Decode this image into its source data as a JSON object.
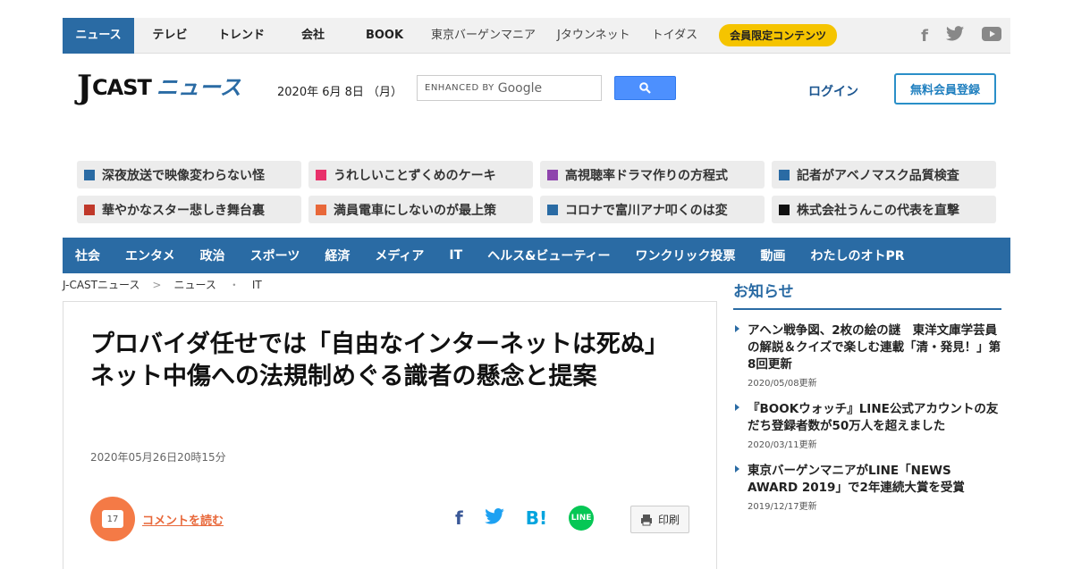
{
  "topnav": {
    "items": [
      "ニュース",
      "テレビ",
      "トレンド",
      "会社",
      "BOOK"
    ],
    "extra": [
      "東京バーゲンマニア",
      "Jタウンネット",
      "トイダス"
    ],
    "member": "会員限定コンテンツ",
    "social": [
      "facebook-icon",
      "twitter-icon",
      "youtube-icon"
    ]
  },
  "header": {
    "logo_j": "J",
    "logo_cast": "CAST",
    "logo_news": "ニュース",
    "date": "2020年 6月 8日 （月）",
    "search_label": "ENHANCED BY",
    "search_brand": "Google",
    "login": "ログイン",
    "register": "無料会員登録"
  },
  "headlines": [
    {
      "text": "深夜放送で映像変わらない怪",
      "color": "#2a6ba4"
    },
    {
      "text": "うれしいことずくめのケーキ",
      "color": "#e8306a"
    },
    {
      "text": "高視聴率ドラマ作りの方程式",
      "color": "#8e44ad"
    },
    {
      "text": "記者がアベノマスク品質検査",
      "color": "#2a6ba4"
    },
    {
      "text": "華やかなスター悲しき舞台裏",
      "color": "#c0392b"
    },
    {
      "text": "満員電車にしないのが最上策",
      "color": "#e8683a"
    },
    {
      "text": "コロナで富川アナ叩くのは変",
      "color": "#2a6ba4"
    },
    {
      "text": "株式会社うんこの代表を直撃",
      "color": "#111111"
    }
  ],
  "catnav": [
    "社会",
    "エンタメ",
    "政治",
    "スポーツ",
    "経済",
    "メディア",
    "IT",
    "ヘルス&ビューティー",
    "ワンクリック投票",
    "動画",
    "わたしのオトPR"
  ],
  "breadcrumb": {
    "home": "J-CASTニュース",
    "sep": ">",
    "section": "ニュース",
    "dot": "・",
    "sub": "IT"
  },
  "article": {
    "title": "プロバイダ任せでは「自由なインターネットは死ぬ」　ネット中傷への法規制めぐる識者の懸念と提案",
    "date": "2020年05月26日20時15分",
    "comment_count": "17",
    "comment_link": "コメントを読む",
    "print": "印刷"
  },
  "sidebar": {
    "heading": "お知らせ",
    "items": [
      {
        "title": "アヘン戦争図、2枚の絵の謎　東洋文庫学芸員の解説＆クイズで楽しむ連載「清・発見！」第8回更新",
        "date": "2020/05/08更新"
      },
      {
        "title": "『BOOKウォッチ』LINE公式アカウントの友だち登録者数が50万人を超えました",
        "date": "2020/03/11更新"
      },
      {
        "title": "東京バーゲンマニアがLINE「NEWS AWARD 2019」で2年連続大賞を受賞",
        "date": "2019/12/17更新"
      }
    ]
  }
}
